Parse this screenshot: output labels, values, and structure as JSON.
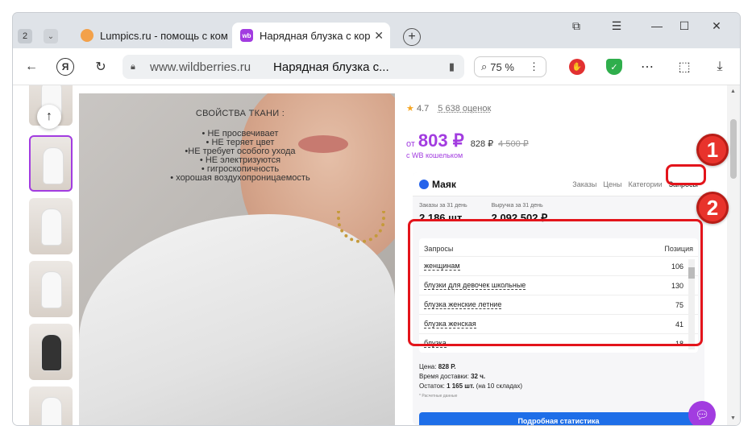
{
  "tabs": {
    "count": "2",
    "inactive_title": "Lumpics.ru - помощь с ком",
    "active_title": "Нарядная блузка с кор",
    "active_favicon": "wb"
  },
  "nav": {
    "yandex_letter": "Я",
    "domain": "www.wildberries.ru",
    "page_title": "Нарядная блузка с...",
    "zoom": "75 %"
  },
  "fabric": {
    "heading": "СВОЙСТВА ТКАНИ :",
    "items": [
      "• НЕ просвечивает",
      "• НЕ теряет цвет",
      "•НЕ требует особого ухода",
      "• НЕ электризуются",
      "• гигроскопичность",
      "• хорошая воздухопроницаемость"
    ]
  },
  "product": {
    "rating": "4.7",
    "reviews": "5 638 оценок",
    "price_from": "от",
    "price_main": "803 ₽",
    "price_sub": "828 ₽",
    "price_old": "4 500 ₽",
    "wallet_note": "с WB кошельком"
  },
  "mayak": {
    "name": "Маяк",
    "tabs": [
      "Заказы",
      "Цены",
      "Категории",
      "Запросы"
    ],
    "orders_label": "Заказы за 31 день",
    "orders_value": "2 186 шт.",
    "revenue_label": "Выручка за 31 день",
    "revenue_value": "2 092 502 ₽.",
    "table_header_query": "Запросы",
    "table_header_position": "Позиция",
    "rows": [
      {
        "q": "женщинам",
        "p": "106"
      },
      {
        "q": "блузки для девочек школьные",
        "p": "130"
      },
      {
        "q": "блузка женские летние",
        "p": "75"
      },
      {
        "q": "блузка женская",
        "p": "41"
      },
      {
        "q": "блузка",
        "p": "18"
      }
    ],
    "price_label": "Цена:",
    "price_value": "828 Р.",
    "delivery_label": "Время доставки:",
    "delivery_value": "32 ч.",
    "stock_label": "Остаток:",
    "stock_value": "1 165 шт.",
    "stock_note": "(на 10 складах)",
    "small_note": "* Расчетные данные",
    "button": "Подробная статистика"
  },
  "annotations": [
    "1",
    "2"
  ],
  "colors": {
    "brand": "#a23ce0",
    "accent": "#1e6ee8",
    "highlight": "#e3141b"
  }
}
